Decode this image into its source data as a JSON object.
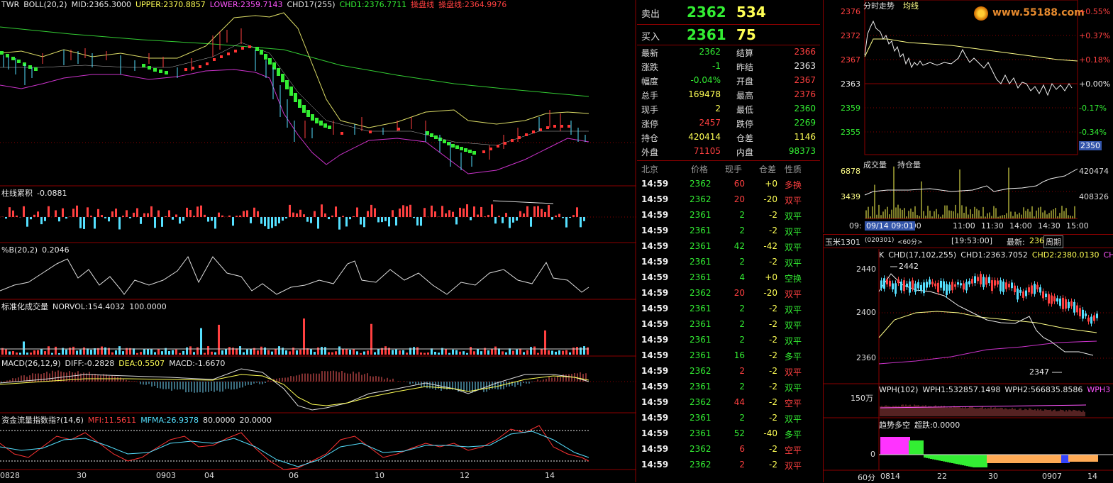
{
  "colors": {
    "up": "#ff4040",
    "down": "#33ee33",
    "accent": "#ffff55",
    "grid": "#8b0000",
    "cyan": "#55e0ff",
    "magenta": "#ff55ff"
  },
  "main_chart": {
    "indicator_labels": [
      {
        "text": "TWR",
        "color": "#e8e8e8"
      },
      {
        "text": "BOLL(20,2)",
        "color": "#e8e8e8"
      },
      {
        "text": "MID:2365.3000",
        "color": "#e8e8e8"
      },
      {
        "text": "UPPER:2370.8857",
        "color": "#ffff55"
      },
      {
        "text": "LOWER:2359.7143",
        "color": "#ff55ff"
      },
      {
        "text": "CHD17(255)",
        "color": "#e8e8e8"
      },
      {
        "text": "CHD1:2376.7711",
        "color": "#33ee33"
      },
      {
        "text": "操盘线",
        "color": "#ff4040"
      },
      {
        "text": "操盘线:2364.9976",
        "color": "#ff4040"
      }
    ],
    "subpanels": [
      {
        "name": "panel-cumulative",
        "labels": [
          {
            "text": "柱线累积",
            "color": "#e8e8e8"
          },
          {
            "text": "-0.0881",
            "color": "#e8e8e8"
          }
        ]
      },
      {
        "name": "panel-pctb",
        "labels": [
          {
            "text": "%B(20,2)",
            "color": "#e8e8e8"
          },
          {
            "text": "0.2046",
            "color": "#e8e8e8"
          }
        ]
      },
      {
        "name": "panel-normvol",
        "labels": [
          {
            "text": "标准化成交量",
            "color": "#e8e8e8"
          },
          {
            "text": "NORVOL:154.4032",
            "color": "#e8e8e8"
          },
          {
            "text": "100.0000",
            "color": "#e8e8e8"
          }
        ]
      },
      {
        "name": "panel-macd",
        "labels": [
          {
            "text": "MACD(26,12,9)",
            "color": "#e8e8e8"
          },
          {
            "text": "DIFF:-0.2828",
            "color": "#e8e8e8"
          },
          {
            "text": "DEA:0.5507",
            "color": "#ffff55"
          },
          {
            "text": "MACD:-1.6670",
            "color": "#e8e8e8"
          }
        ]
      },
      {
        "name": "panel-mfi",
        "labels": [
          {
            "text": "资金流量指数指?(14,6)",
            "color": "#e8e8e8"
          },
          {
            "text": "MFI:11.5611",
            "color": "#ff4040"
          },
          {
            "text": "MFMA:26.9378",
            "color": "#55e0ff"
          },
          {
            "text": "80.0000",
            "color": "#e8e8e8"
          },
          {
            "text": "20.0000",
            "color": "#e8e8e8"
          }
        ]
      }
    ],
    "date_axis": [
      "0828",
      "30",
      "0903",
      "04",
      "06",
      "10",
      "12",
      "14"
    ]
  },
  "quote": {
    "sell": {
      "label": "卖出",
      "price": "2362",
      "volume": "534"
    },
    "buy": {
      "label": "买入",
      "price": "2361",
      "volume": "75"
    },
    "rows": [
      {
        "l": "最新",
        "lv": "2362",
        "lc": "#33ee33",
        "r": "结算",
        "rv": "2366",
        "rc": "#ff4040"
      },
      {
        "l": "涨跌",
        "lv": "-1",
        "lc": "#33ee33",
        "r": "昨结",
        "rv": "2363",
        "rc": "#e8e8e8"
      },
      {
        "l": "幅度",
        "lv": "-0.04%",
        "lc": "#33ee33",
        "r": "开盘",
        "rv": "2367",
        "rc": "#ff4040"
      },
      {
        "l": "总手",
        "lv": "169478",
        "lc": "#ffff55",
        "r": "最高",
        "rv": "2376",
        "rc": "#ff4040"
      },
      {
        "l": "现手",
        "lv": "2",
        "lc": "#ffff55",
        "r": "最低",
        "rv": "2360",
        "rc": "#33ee33"
      },
      {
        "l": "涨停",
        "lv": "2457",
        "lc": "#ff4040",
        "r": "跌停",
        "rv": "2269",
        "rc": "#33ee33"
      },
      {
        "l": "持仓",
        "lv": "420414",
        "lc": "#ffff55",
        "r": "仓差",
        "rv": "1146",
        "rc": "#ffff55"
      },
      {
        "l": "外盘",
        "lv": "71105",
        "lc": "#ff4040",
        "r": "内盘",
        "rv": "98373",
        "rc": "#33ee33"
      }
    ],
    "tick_header": [
      "北京",
      "价格",
      "现手",
      "仓差",
      "性质"
    ],
    "ticks": [
      {
        "t": "14:59",
        "p": "2362",
        "pc": "#33ee33",
        "v": "60",
        "vc": "#ff4040",
        "d": "+0",
        "dc": "#ffff55",
        "n": "多换",
        "nc": "#ff4040"
      },
      {
        "t": "14:59",
        "p": "2362",
        "pc": "#33ee33",
        "v": "20",
        "vc": "#ff4040",
        "d": "-20",
        "dc": "#ffff55",
        "n": "双平",
        "nc": "#ff4040"
      },
      {
        "t": "14:59",
        "p": "2361",
        "pc": "#33ee33",
        "v": "2",
        "vc": "#33ee33",
        "d": "-2",
        "dc": "#ffff55",
        "n": "双平",
        "nc": "#33ee33"
      },
      {
        "t": "14:59",
        "p": "2361",
        "pc": "#33ee33",
        "v": "2",
        "vc": "#33ee33",
        "d": "-2",
        "dc": "#ffff55",
        "n": "双平",
        "nc": "#33ee33"
      },
      {
        "t": "14:59",
        "p": "2361",
        "pc": "#33ee33",
        "v": "42",
        "vc": "#33ee33",
        "d": "-42",
        "dc": "#ffff55",
        "n": "双平",
        "nc": "#33ee33"
      },
      {
        "t": "14:59",
        "p": "2361",
        "pc": "#33ee33",
        "v": "2",
        "vc": "#33ee33",
        "d": "-2",
        "dc": "#ffff55",
        "n": "双平",
        "nc": "#33ee33"
      },
      {
        "t": "14:59",
        "p": "2361",
        "pc": "#33ee33",
        "v": "4",
        "vc": "#33ee33",
        "d": "+0",
        "dc": "#ffff55",
        "n": "空换",
        "nc": "#33ee33"
      },
      {
        "t": "14:59",
        "p": "2362",
        "pc": "#33ee33",
        "v": "20",
        "vc": "#ff4040",
        "d": "-20",
        "dc": "#ffff55",
        "n": "双平",
        "nc": "#ff4040"
      },
      {
        "t": "14:59",
        "p": "2361",
        "pc": "#33ee33",
        "v": "2",
        "vc": "#33ee33",
        "d": "-2",
        "dc": "#ffff55",
        "n": "双平",
        "nc": "#33ee33"
      },
      {
        "t": "14:59",
        "p": "2361",
        "pc": "#33ee33",
        "v": "2",
        "vc": "#33ee33",
        "d": "-2",
        "dc": "#ffff55",
        "n": "双平",
        "nc": "#33ee33"
      },
      {
        "t": "14:59",
        "p": "2361",
        "pc": "#33ee33",
        "v": "2",
        "vc": "#33ee33",
        "d": "-2",
        "dc": "#ffff55",
        "n": "双平",
        "nc": "#33ee33"
      },
      {
        "t": "14:59",
        "p": "2361",
        "pc": "#33ee33",
        "v": "16",
        "vc": "#33ee33",
        "d": "-2",
        "dc": "#ffff55",
        "n": "多平",
        "nc": "#33ee33"
      },
      {
        "t": "14:59",
        "p": "2362",
        "pc": "#33ee33",
        "v": "2",
        "vc": "#ff4040",
        "d": "-2",
        "dc": "#ffff55",
        "n": "双平",
        "nc": "#ff4040"
      },
      {
        "t": "14:59",
        "p": "2361",
        "pc": "#33ee33",
        "v": "2",
        "vc": "#33ee33",
        "d": "-2",
        "dc": "#ffff55",
        "n": "双平",
        "nc": "#33ee33"
      },
      {
        "t": "14:59",
        "p": "2362",
        "pc": "#33ee33",
        "v": "44",
        "vc": "#ff4040",
        "d": "-2",
        "dc": "#ffff55",
        "n": "空平",
        "nc": "#ff4040"
      },
      {
        "t": "14:59",
        "p": "2361",
        "pc": "#33ee33",
        "v": "2",
        "vc": "#33ee33",
        "d": "-2",
        "dc": "#ffff55",
        "n": "双平",
        "nc": "#33ee33"
      },
      {
        "t": "14:59",
        "p": "2361",
        "pc": "#33ee33",
        "v": "52",
        "vc": "#33ee33",
        "d": "-40",
        "dc": "#ffff55",
        "n": "多平",
        "nc": "#33ee33"
      },
      {
        "t": "14:59",
        "p": "2362",
        "pc": "#33ee33",
        "v": "6",
        "vc": "#ff4040",
        "d": "-2",
        "dc": "#ffff55",
        "n": "空平",
        "nc": "#ff4040"
      },
      {
        "t": "14:59",
        "p": "2362",
        "pc": "#33ee33",
        "v": "2",
        "vc": "#ff4040",
        "d": "-2",
        "dc": "#ffff55",
        "n": "双平",
        "nc": "#ff4040"
      }
    ]
  },
  "intraday": {
    "title": "分时走势",
    "avg_label": "均线",
    "price_ticks": [
      {
        "p": "2376",
        "pct": "+0.55%"
      },
      {
        "p": "2372",
        "pct": "+0.37%"
      },
      {
        "p": "2367",
        "pct": "+0.18%"
      },
      {
        "p": "2363",
        "pct": "+0.00%"
      },
      {
        "p": "2359",
        "pct": "-0.17%"
      },
      {
        "p": "2355",
        "pct": "-0.34%"
      }
    ],
    "cursor_value": "2350",
    "volume_title": "成交量",
    "oi_title": "持仓量",
    "vol_ticks": [
      "6878",
      "3439"
    ],
    "oi_ticks": [
      "420474",
      "408326"
    ],
    "time_axis": [
      "09:",
      "09:00",
      "11:00",
      "11:30",
      "14:00",
      "14:30",
      "15:00"
    ],
    "cursor_time": "09/14 09:01",
    "watermark": "www.55188.com"
  },
  "minichart": {
    "symbol": "玉米1301",
    "code": "(020301)",
    "period": "<60分>",
    "time": "[19:53:00]",
    "latest_label": "最新:",
    "latest_value": "236",
    "period_btn": "周期",
    "labels": [
      {
        "text": "K",
        "color": "#e8e8e8"
      },
      {
        "text": "CHD(17,102,255)",
        "color": "#e8e8e8"
      },
      {
        "text": "CHD1:2363.7052",
        "color": "#e8e8e8"
      },
      {
        "text": "CHD2:2380.0130",
        "color": "#ffff55"
      },
      {
        "text": "CH",
        "color": "#ff55ff"
      }
    ],
    "price_ticks": [
      "2440",
      "2400",
      "2360"
    ],
    "high_mark": "2442",
    "low_mark": "2347",
    "wph_labels": [
      {
        "text": "WPH(102)",
        "color": "#e8e8e8"
      },
      {
        "text": "WPH1:532857.1498",
        "color": "#e8e8e8"
      },
      {
        "text": "WPH2:566835.8586",
        "color": "#e8e8e8"
      },
      {
        "text": "WPH3",
        "color": "#ff55ff"
      }
    ],
    "wph_tick": "150万",
    "trend_labels": [
      {
        "text": "趋势多空",
        "color": "#e8e8e8"
      },
      {
        "text": "超跌:0.0000",
        "color": "#e8e8e8"
      }
    ],
    "trend_tick": "0",
    "axis": [
      "60分",
      "0814",
      "22",
      "30",
      "0907",
      "14"
    ]
  }
}
